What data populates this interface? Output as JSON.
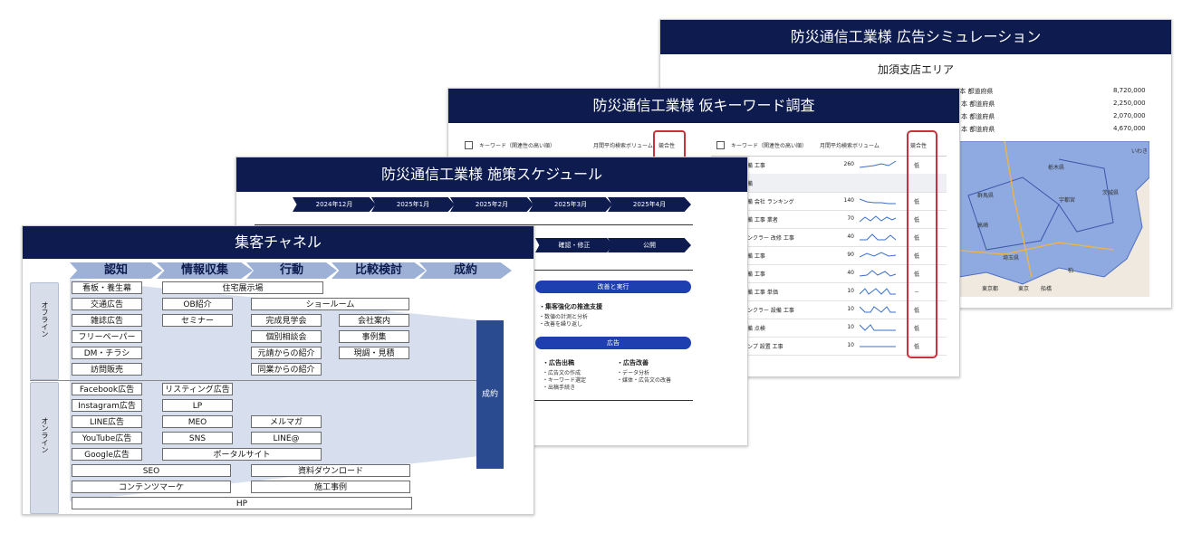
{
  "simulation": {
    "title": "防災通信工業様 広告シミュレーション",
    "area_title": "加須支店エリア",
    "rows": [
      {
        "label": "埼玉県 日本 都道府県",
        "value": "8,720,000"
      },
      {
        "label": "日本 都道府県",
        "value": "2,250,000"
      },
      {
        "label": "日本 都道府県",
        "value": "2,070,000"
      },
      {
        "label": "日本 都道府県",
        "value": "4,670,000"
      }
    ],
    "map_labels": [
      "いわき",
      "栃木県",
      "宇都宮",
      "茨城県",
      "群馬県",
      "高崎",
      "埼玉県",
      "柏",
      "東京都",
      "東京",
      "船橋"
    ]
  },
  "keywords": {
    "title": "防災通信工業様 仮キーワード調査",
    "col_keyword": "キーワード（関連性の高い順）",
    "col_volume": "月間平均検索ボリューム",
    "col_competition": "競合性",
    "rows": [
      {
        "keyword": "防災設備 工事",
        "volume": "260",
        "competition": "低"
      },
      {
        "keyword": "防災設備",
        "volume": "",
        "competition": ""
      },
      {
        "keyword": "防災設備 会社 ランキング",
        "volume": "140",
        "competition": "低"
      },
      {
        "keyword": "防災設備 工事 業者",
        "volume": "70",
        "competition": "低"
      },
      {
        "keyword": "スプリンクラー 改修 工事",
        "volume": "40",
        "competition": "低"
      },
      {
        "keyword": "消防設備 工事",
        "volume": "90",
        "competition": "低"
      },
      {
        "keyword": "消防設備 工事",
        "volume": "40",
        "competition": "低"
      },
      {
        "keyword": "消防設備 工事 単価",
        "volume": "10",
        "competition": "－"
      },
      {
        "keyword": "スプリンクラー 設備 工事",
        "volume": "10",
        "competition": "低"
      },
      {
        "keyword": "消防設備 点検",
        "volume": "10",
        "competition": "低"
      },
      {
        "keyword": "消防ポンプ 設置 工事",
        "volume": "10",
        "competition": "低"
      }
    ]
  },
  "schedule": {
    "title": "防災通信工業様 施策スケジュール",
    "months": [
      "2024年12月",
      "2025年1月",
      "2025年2月",
      "2025年3月",
      "2025年4月"
    ],
    "phase2": [
      "確認・修正",
      "公開"
    ],
    "pill_improve": "改善と実行",
    "improve_head": "・集客強化の推進支援",
    "improve_items": [
      "・数値の計測と分析",
      "・改善を繰り返し"
    ],
    "pill_ad": "広告",
    "ad_col1_head": "・広告出稿",
    "ad_col1_items": [
      "・広告文の作成",
      "・キーワード選定",
      "・出稿手続き"
    ],
    "ad_col2_head": "・広告改善",
    "ad_col2_items": [
      "・データ分析",
      "・媒体・広告文の改善"
    ]
  },
  "channel": {
    "title": "集客チャネル",
    "stages": [
      "認知",
      "情報収集",
      "行動",
      "比較検討",
      "成約"
    ],
    "offline_label": "オフライン",
    "online_label": "オンライン",
    "conversion_label": "成約",
    "offline": {
      "c1": [
        "看板・養生幕",
        "交通広告",
        "雑誌広告",
        "フリーペーパー",
        "DM・チラシ",
        "訪問販売"
      ],
      "wide1": "住宅展示場",
      "c2": [
        "OB紹介",
        "セミナー"
      ],
      "wide2": "ショールーム",
      "c3": [
        "完成見学会",
        "個別相談会",
        "元請からの紹介",
        "同業からの紹介"
      ],
      "c4": [
        "会社案内",
        "事例集",
        "現調・見積"
      ]
    },
    "online": {
      "c1": [
        "Facebook広告",
        "Instagram広告",
        "LINE広告",
        "YouTube広告",
        "Google広告"
      ],
      "c2": [
        "リスティング広告",
        "LP",
        "MEO",
        "SNS"
      ],
      "c3": [
        "メルマガ",
        "LINE@"
      ],
      "portal": "ポータルサイト",
      "seo": "SEO",
      "download": "資料ダウンロード",
      "content": "コンテンツマーケ",
      "cases": "施工事例",
      "hp": "HP"
    }
  },
  "colors": {
    "navy": "#0d1b4f",
    "stage_blue": "#9db1d6",
    "conversion_bar": "#2a4b8f",
    "funnel": "#c9d4e8",
    "pill_blue": "#1e3fb0",
    "highlight_red": "#c8323c"
  }
}
